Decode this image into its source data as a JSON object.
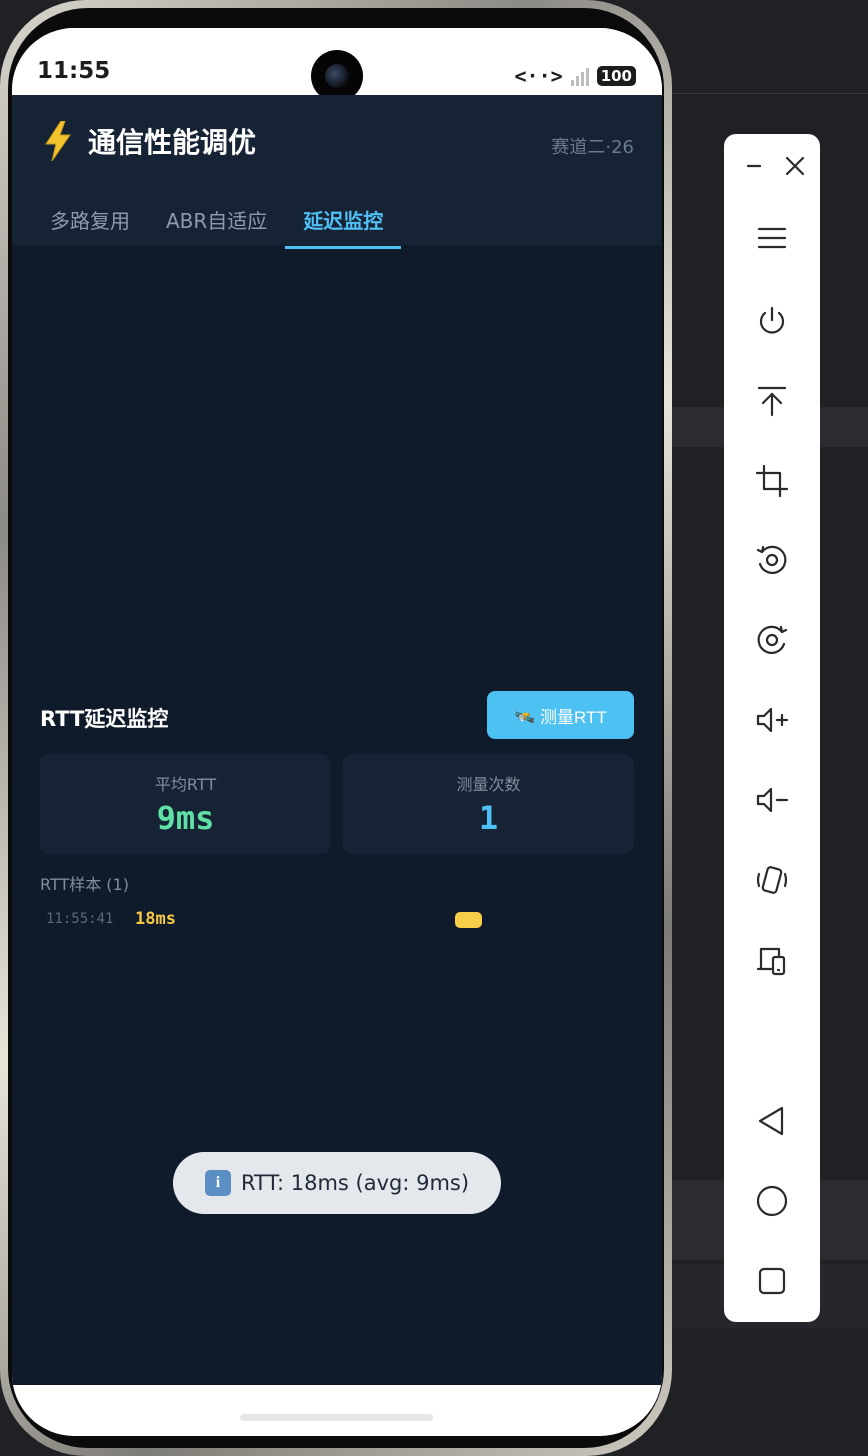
{
  "status_bar": {
    "time": "11:55",
    "network": "<··>",
    "battery": "100"
  },
  "app": {
    "title": "通信性能调优",
    "badge": "赛道二·26",
    "tabs": [
      {
        "label": "多路复用",
        "active": false
      },
      {
        "label": "ABR自适应",
        "active": false
      },
      {
        "label": "延迟监控",
        "active": true
      }
    ]
  },
  "rtt": {
    "section_title": "RTT延迟监控",
    "measure_button": "🛰️ 测量RTT",
    "stats": [
      {
        "label": "平均RTT",
        "value": "9ms",
        "color": "#5fe0a4"
      },
      {
        "label": "测量次数",
        "value": "1",
        "color": "#4fc0f5"
      }
    ],
    "samples_title": "RTT样本 (1)",
    "samples": [
      {
        "time": "11:55:41",
        "value": "18ms",
        "color": "#f8cf4a"
      }
    ]
  },
  "toast": {
    "icon": "i",
    "message": "RTT: 18ms (avg: 9ms)"
  },
  "toolbar": {
    "buttons": [
      "minimize-icon",
      "close-icon",
      "menu-icon",
      "power-icon",
      "upload-icon",
      "crop-icon",
      "rotate-left-icon",
      "rotate-right-icon",
      "volume-up-icon",
      "volume-down-icon",
      "shake-icon",
      "device-icon",
      "back-icon",
      "home-icon",
      "recents-icon"
    ]
  },
  "colors": {
    "app_bg": "#0f1b2b",
    "header_bg": "#162334",
    "accent": "#4fc0f5",
    "rtt_avg": "#5fe0a4",
    "sample": "#f8cf4a"
  }
}
